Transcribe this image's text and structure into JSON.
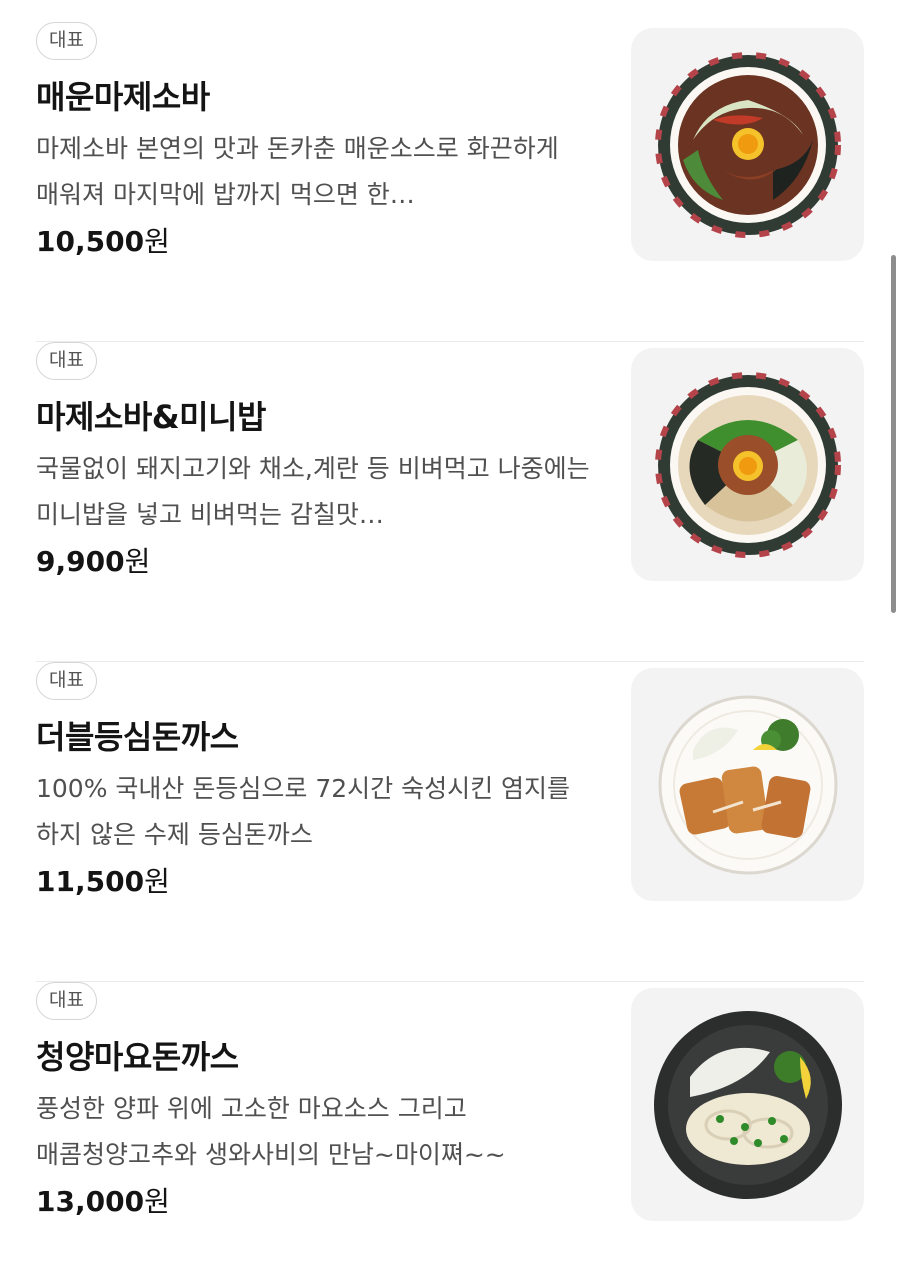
{
  "menu": {
    "items": [
      {
        "badge": "대표",
        "name": "매운마제소바",
        "description": "마제소바 본연의 맛과 돈카춘 매운소스로 화끈하게 매워져 마지막에 밥까지 먹으면 한…",
        "price": "10,500",
        "currency": "원",
        "image_icon": "spicy-mazesoba-bowl-icon"
      },
      {
        "badge": "대표",
        "name": "마제소바&미니밥",
        "description": "국물없이 돼지고기와 채소,계란 등 비벼먹고 나중에는 미니밥을 넣고 비벼먹는 감칠맛…",
        "price": "9,900",
        "currency": "원",
        "image_icon": "mazesoba-bowl-icon"
      },
      {
        "badge": "대표",
        "name": "더블등심돈까스",
        "description": "100% 국내산 돈등심으로 72시간 숙성시킨 염지를 하지 않은 수제 등심돈까스",
        "price": "11,500",
        "currency": "원",
        "image_icon": "pork-cutlet-plate-icon"
      },
      {
        "badge": "대표",
        "name": "청양마요돈까스",
        "description": "풍성한 양파 위에 고소한 마요소스 그리고 매콤청양고추와 생와사비의 만남~마이쪄~~",
        "price": "13,000",
        "currency": "원",
        "image_icon": "mayo-cutlet-plate-icon"
      }
    ]
  },
  "colors": {
    "badge_border": "#d5d5d5",
    "divider": "#ebebeb",
    "thumb_bg": "#f3f3f3",
    "scrollbar": "#8d8d8d"
  }
}
